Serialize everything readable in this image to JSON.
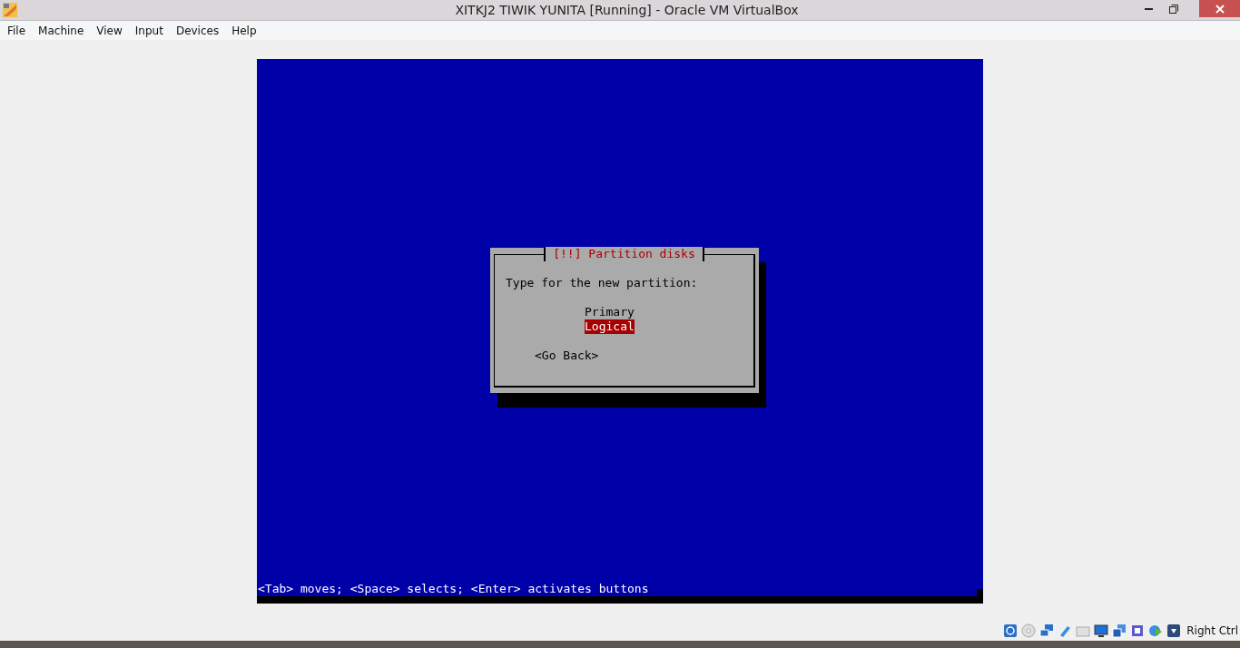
{
  "window": {
    "title": "XITKJ2 TIWIK YUNITA [Running] - Oracle VM VirtualBox"
  },
  "menu": [
    "File",
    "Machine",
    "View",
    "Input",
    "Devices",
    "Help"
  ],
  "dialog": {
    "title": "[!!] Partition disks",
    "prompt": "Type for the new partition:",
    "options": [
      {
        "label": "Primary",
        "selected": false
      },
      {
        "label": "Logical",
        "selected": true
      }
    ],
    "back_button": "<Go Back>"
  },
  "hint": "<Tab> moves; <Space> selects; <Enter> activates buttons",
  "status_bar": {
    "host_key": "Right Ctrl"
  }
}
